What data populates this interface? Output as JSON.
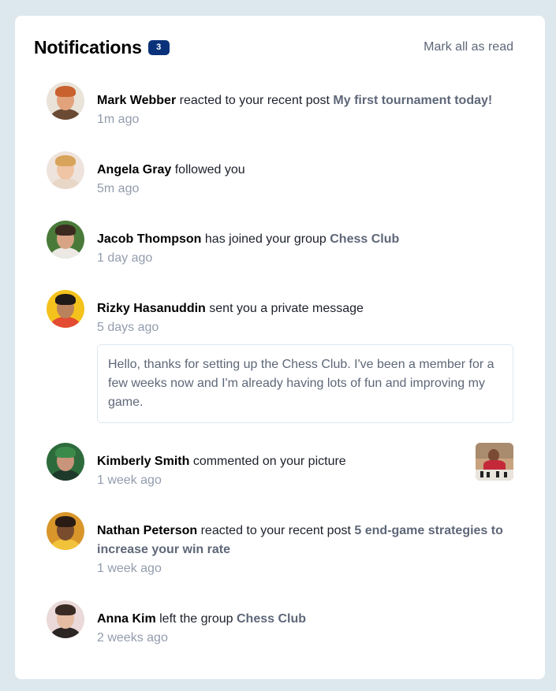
{
  "header": {
    "title": "Notifications",
    "unread_count": "3",
    "mark_all_label": "Mark all as read"
  },
  "notifications": [
    {
      "name": "Mark Webber",
      "action": "reacted to your recent post",
      "ref": "My first tournament today!",
      "time": "1m ago"
    },
    {
      "name": "Angela Gray",
      "action": "followed you",
      "ref": "",
      "time": "5m ago"
    },
    {
      "name": "Jacob Thompson",
      "action": "has joined your group",
      "ref": "Chess Club",
      "time": "1 day ago"
    },
    {
      "name": "Rizky Hasanuddin",
      "action": "sent you a private message",
      "ref": "",
      "time": "5 days ago",
      "message": "Hello, thanks for setting up the Chess Club. I've been a member for a few weeks now and I'm already having lots of fun and improving my game."
    },
    {
      "name": "Kimberly Smith",
      "action": "commented on your picture",
      "ref": "",
      "time": "1 week ago"
    },
    {
      "name": "Nathan Peterson",
      "action": "reacted to your recent post",
      "ref": "5 end-game strategies to increase your win rate",
      "time": "1 week ago"
    },
    {
      "name": "Anna Kim",
      "action": "left the group",
      "ref": "Chess Club",
      "time": "2 weeks ago"
    }
  ],
  "colors": {
    "badge": "#0a327b",
    "background": "#dde7ee",
    "muted": "#939cad",
    "secondary": "#5e6778"
  }
}
